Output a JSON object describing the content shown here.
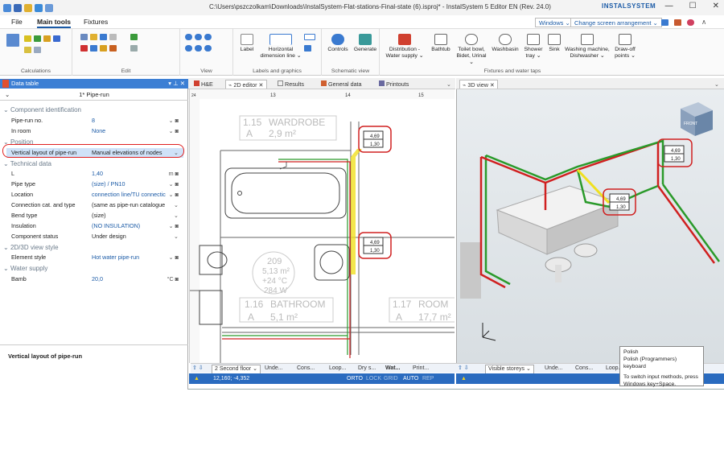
{
  "window": {
    "title": "C:\\Users\\pszczolkam\\Downloads\\InstalSystem-Flat-stations-Final-state (6).isproj* - InstalSystem 5 Editor EN (Rev. 24.0)",
    "brand": "INSTALSYSTEM",
    "minimize": "—",
    "maximize": "☐",
    "close": "✕"
  },
  "menu": {
    "file": "File",
    "main_tools": "Main tools",
    "fixtures": "Fixtures",
    "windows_combo": "Windows ⌄",
    "screen_combo": "Change screen arrangement ⌄"
  },
  "ribbon": {
    "groups": {
      "calculations": "Calculations",
      "edit": "Edit",
      "view": "View",
      "labels": "Labels and graphics",
      "schematic": "Schematic view",
      "fixtures": "Fixtures and water taps"
    },
    "buttons": {
      "label": "Label",
      "hdim": "Horizontal",
      "hdim2": "dimension line ⌄",
      "controls": "Controls",
      "generate": "Generate",
      "distribution": "Distribution -",
      "distribution2": "Water supply ⌄",
      "bathtub": "Bathtub",
      "toilet": "Toilet bowl,",
      "toilet2": "Bidet, Urinal ⌄",
      "washbasin": "Washbasin",
      "shower": "Shower",
      "shower2": "tray ⌄",
      "sink": "Sink",
      "washing": "Washing machine,",
      "washing2": "Dishwasher ⌄",
      "drawoff": "Draw-off",
      "drawoff2": "points ⌄"
    }
  },
  "datatable": {
    "title": "Data table",
    "selector": "1* Pipe-run",
    "categories": {
      "ident": "Component identification",
      "position": "Position",
      "technical": "Technical data",
      "style": "2D/3D view style",
      "water": "Water supply"
    },
    "rows": {
      "pipe_no": {
        "key": "Pipe-run no.",
        "value": "8"
      },
      "in_room": {
        "key": "In room",
        "value": "None"
      },
      "vlayout": {
        "key": "Vertical layout of pipe-run",
        "value": "Manual elevations of nodes"
      },
      "length": {
        "key": "L",
        "value": "1,40",
        "unit": "m"
      },
      "pipe_type": {
        "key": "Pipe type",
        "value": "(size) / PN10"
      },
      "location": {
        "key": "Location",
        "value": "connection line/TU connectic"
      },
      "conn_cat": {
        "key": "Connection cat. and type",
        "value": "(same as pipe-run catalogue"
      },
      "bend_type": {
        "key": "Bend type",
        "value": "(size)"
      },
      "insulation": {
        "key": "Insulation",
        "value": "(NO INSULATION)"
      },
      "status": {
        "key": "Component status",
        "value": "Under design"
      },
      "element_style": {
        "key": "Element style",
        "value": "Hot water pipe-run"
      },
      "bamb": {
        "key": "Bamb",
        "value": "20,0",
        "unit": "°C"
      }
    },
    "description": "Vertical layout of pipe-run"
  },
  "center": {
    "tabs": [
      "H&E",
      "2D editor",
      "Results",
      "General data",
      "Printouts"
    ],
    "rooms": {
      "wardrobe_no": "1.15",
      "wardrobe": "WARDROBE",
      "wardrobe_area_l": "A",
      "wardrobe_area": "2,9 m²",
      "room209": "209",
      "r209_area": "5,13 m²",
      "r209_temp": "+24 °C",
      "r209_w": "284 W",
      "bathroom_no": "1.16",
      "bathroom": "BATHROOM",
      "bath_a": "A",
      "bath_area": "5,1 m²",
      "room_no": "1.17",
      "room": "ROOM",
      "room_a": "A",
      "room_area": "17,7 m²"
    },
    "ruler": [
      "13",
      "14",
      "15"
    ],
    "ruler_left": "24",
    "elev_top": "4,69",
    "elev_bot": "1,30",
    "floor": "2 Second floor",
    "status_items": [
      "Unde...",
      "Cons...",
      "Loop...",
      "Dry s...",
      "Wat...",
      "Print..."
    ],
    "coords": "12,160; -4,352",
    "modes": [
      "ORTO",
      "LOCK",
      "GRID",
      "AUTO",
      "REP"
    ]
  },
  "right": {
    "tab": "3D view",
    "elev_top": "4,69",
    "elev_bot": "1,30",
    "visible_storeys": "Visible storeys",
    "status_items": [
      "Unde...",
      "Cons...",
      "Loop..."
    ],
    "cube_face": "FRONT"
  },
  "tooltip": {
    "line1": "Polish",
    "line2": "Polish (Programmers) keyboard",
    "line3": "To switch input methods, press",
    "line4": "Windows key+Space."
  }
}
